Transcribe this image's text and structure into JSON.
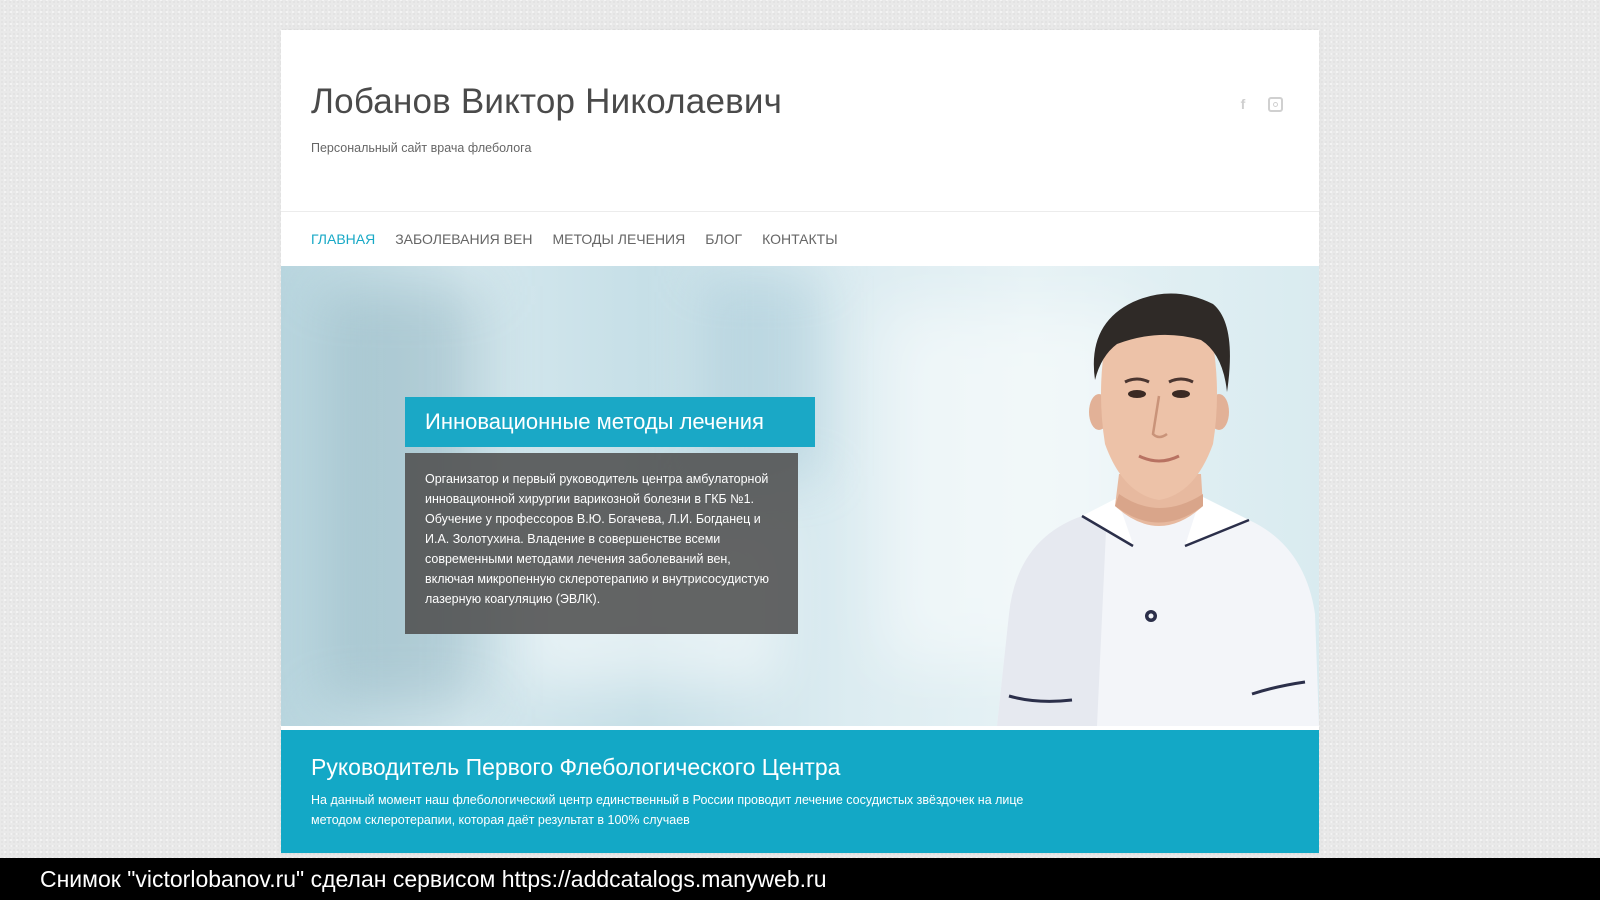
{
  "site": {
    "title": "Лобанов Виктор Николаевич",
    "tagline": "Персональный сайт врача флеболога"
  },
  "social": {
    "icons": [
      "facebook-icon",
      "instagram-icon"
    ],
    "facebook_glyph": "f"
  },
  "nav": {
    "items": [
      {
        "label": "ГЛАВНАЯ",
        "active": true
      },
      {
        "label": "ЗАБОЛЕВАНИЯ ВЕН",
        "active": false
      },
      {
        "label": "МЕТОДЫ ЛЕЧЕНИЯ",
        "active": false
      },
      {
        "label": "БЛОГ",
        "active": false
      },
      {
        "label": "КОНТАКТЫ",
        "active": false
      }
    ]
  },
  "hero": {
    "caption_title": "Инновационные методы лечения",
    "caption_text": "Организатор и первый руководитель центра амбулаторной инновационной хирургии варикозной болезни в ГКБ №1. Обучение у профессоров В.Ю. Богачева, Л.И. Богданец и И.А. Золотухина. Владение в совершенстве всеми современными методами лечения заболеваний вен, включая микропенную склеротерапию и внутрисосудистую лазерную коагуляцию (ЭВЛК)."
  },
  "banner": {
    "title": "Руководитель Первого Флебологического Центра",
    "text": "На данный момент наш флебологический центр единственный в России проводит лечение сосудистых звёздочек на лице методом склеротерапии, которая даёт результат в 100% случаев"
  },
  "capture": {
    "text": "Снимок \"victorlobanov.ru\" сделан сервисом https://addcatalogs.manyweb.ru"
  },
  "colors": {
    "accent": "#18a9c6",
    "caption_bg": "#505050",
    "page_bg": "#e9e9e9"
  }
}
